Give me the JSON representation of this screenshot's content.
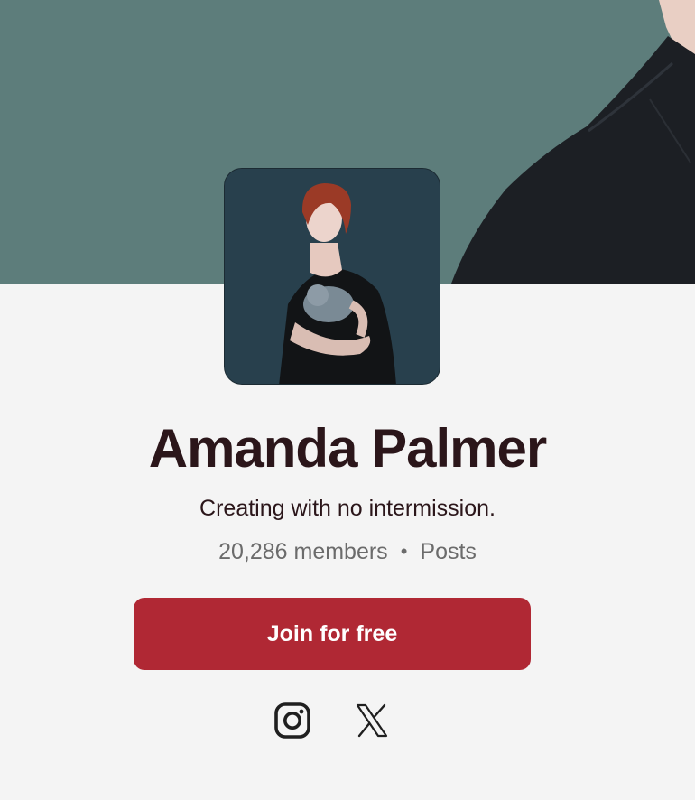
{
  "creator": {
    "name": "Amanda Palmer",
    "tagline": "Creating with no intermission.",
    "members": "20,286 members",
    "separator": "•",
    "posts_link": "Posts"
  },
  "actions": {
    "join_label": "Join for free"
  },
  "social": [
    {
      "icon": "instagram-icon"
    },
    {
      "icon": "x-twitter-icon"
    }
  ],
  "colors": {
    "cover_bg": "#5d7d7b",
    "page_bg": "#f4f4f4",
    "brand_button": "#b02834",
    "heading_text": "#2b161a",
    "muted_text": "#6b6b6b"
  }
}
